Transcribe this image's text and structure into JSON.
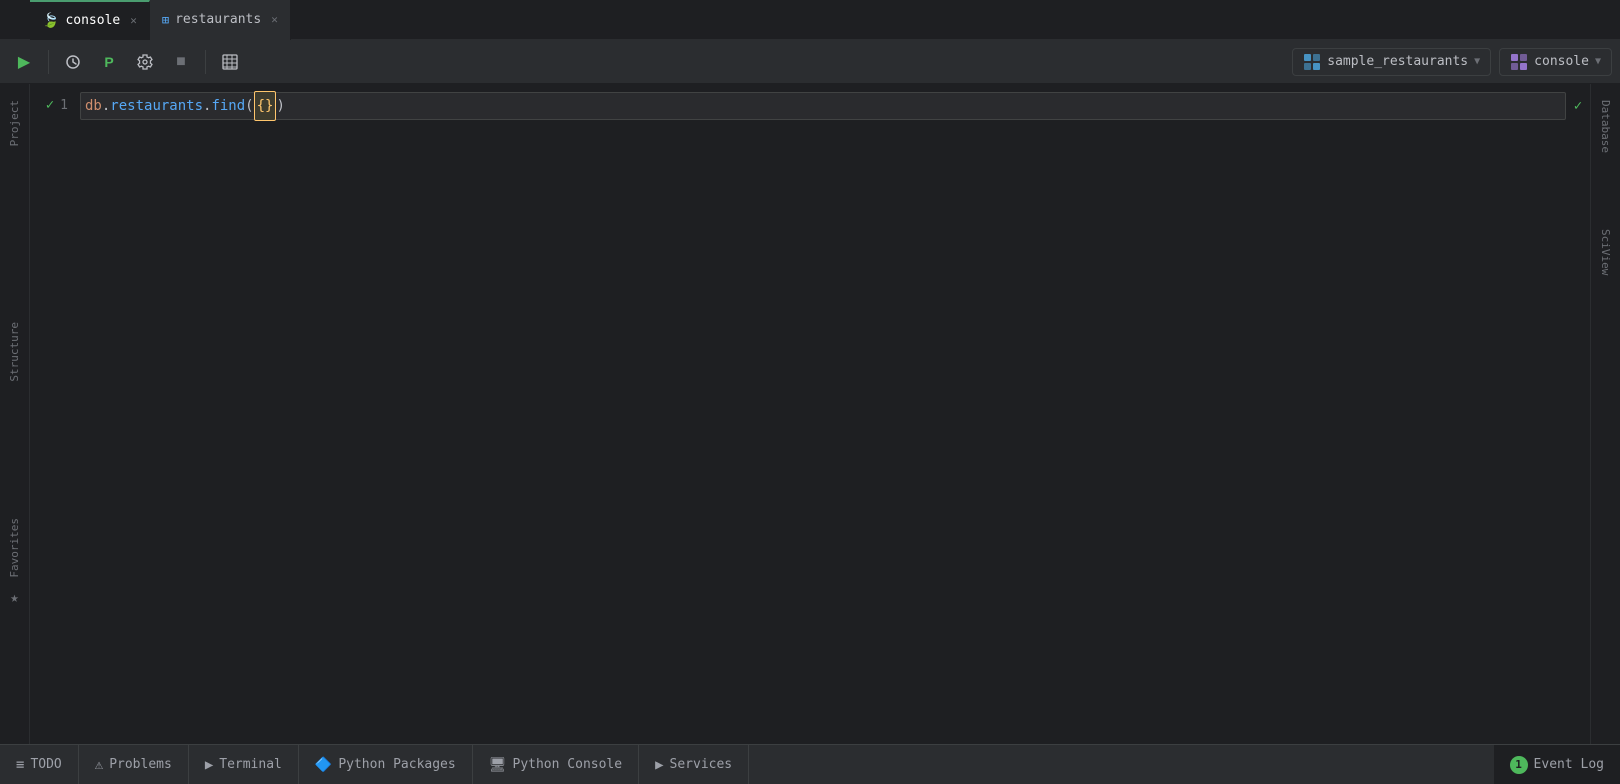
{
  "tabs": [
    {
      "id": "console",
      "label": "console",
      "icon": "🍃",
      "active": true,
      "closable": true
    },
    {
      "id": "restaurants",
      "label": "restaurants",
      "icon": "⊞",
      "active": false,
      "closable": true
    }
  ],
  "toolbar": {
    "run_label": "▶",
    "history_label": "⏱",
    "python_label": "P",
    "wrench_label": "🔧",
    "stop_label": "■",
    "table_label": "☰",
    "db_selector": "sample_restaurants",
    "console_selector": "console"
  },
  "editor": {
    "line_number": "1",
    "code": "db.restaurants.find({})"
  },
  "right_sidebar": {
    "database_label": "Database",
    "sciview_label": "SciView"
  },
  "left_sidebar": {
    "project_label": "Project",
    "structure_label": "Structure",
    "favorites_label": "Favorites"
  },
  "status_bar": {
    "todo_label": "TODO",
    "problems_label": "Problems",
    "terminal_label": "Terminal",
    "python_packages_label": "Python Packages",
    "python_console_label": "Python Console",
    "services_label": "Services",
    "event_log_label": "Event Log",
    "event_log_count": "1"
  }
}
